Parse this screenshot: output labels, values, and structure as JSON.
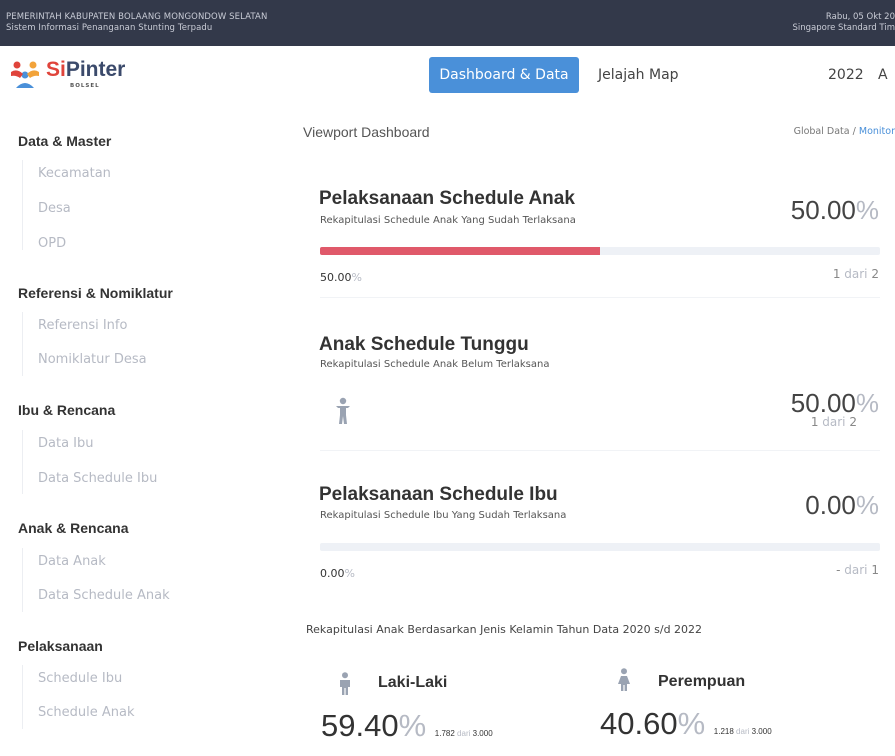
{
  "topbar": {
    "org": "PEMERINTAH KABUPATEN BOLAANG MONGONDOW SELATAN",
    "system": "Sistem Informasi Penanganan Stunting Terpadu",
    "date": "Rabu, 05 Okt 20",
    "timezone": "Singapore Standard Tim"
  },
  "header": {
    "logo_si": "Si",
    "logo_pinter": "Pinter",
    "logo_sub": "BOLSEL",
    "nav_active": "Dashboard & Data",
    "nav_link": "Jelajah Map",
    "year": "2022",
    "user_initial": "A"
  },
  "sidebar": {
    "sections": [
      {
        "title": "Data & Master",
        "items": [
          "Kecamatan",
          "Desa",
          "OPD"
        ]
      },
      {
        "title": "Referensi & Nomiklatur",
        "items": [
          "Referensi Info",
          "Nomiklatur Desa"
        ]
      },
      {
        "title": "Ibu & Rencana",
        "items": [
          "Data Ibu",
          "Data Schedule Ibu"
        ]
      },
      {
        "title": "Anak & Rencana",
        "items": [
          "Data Anak",
          "Data Schedule Anak"
        ]
      },
      {
        "title": "Pelaksanaan",
        "items": [
          "Schedule Ibu",
          "Schedule Anak"
        ]
      }
    ]
  },
  "main": {
    "title": "Viewport Dashboard",
    "breadcrumb": {
      "root": "Global Data",
      "sep": "/",
      "current": "Monitor"
    },
    "cards": [
      {
        "title": "Pelaksanaan Schedule Anak",
        "subtitle": "Rekapitulasi Schedule Anak Yang Sudah Terlaksana",
        "percent": "50.00",
        "progress": 0.5,
        "progress_label": "50.00",
        "count": "1",
        "of": "dari",
        "total": "2",
        "bar_color": "#e0596a"
      },
      {
        "title": "Anak Schedule Tunggu",
        "subtitle": "Rekapitulasi Schedule Anak Belum Terlaksana",
        "percent": "50.00",
        "count": "1",
        "of": "dari",
        "total": "2",
        "icon": "child-icon"
      },
      {
        "title": "Pelaksanaan Schedule Ibu",
        "subtitle": "Rekapitulasi Schedule Ibu Yang Sudah Terlaksana",
        "percent": "0.00",
        "progress": 0.0,
        "progress_label": "0.00",
        "count": "-",
        "of": "dari",
        "total": "1"
      }
    ],
    "pct_symbol": "%",
    "rekap": {
      "title": "Rekapitulasi Anak Berdasarkan Jenis Kelamin Tahun Data 2020 s/d 2022",
      "male": {
        "label": "Laki-Laki",
        "percent": "59.40",
        "count": "1.782",
        "of": "dari",
        "total": "3.000",
        "icon": "male-icon"
      },
      "female": {
        "label": "Perempuan",
        "percent": "40.60",
        "count": "1.218",
        "of": "dari",
        "total": "3.000",
        "icon": "female-icon"
      }
    }
  },
  "colors": {
    "topbar": "#33394a",
    "accent": "#4a90d9",
    "progress": "#e0596a",
    "muted": "#b6bac4"
  }
}
